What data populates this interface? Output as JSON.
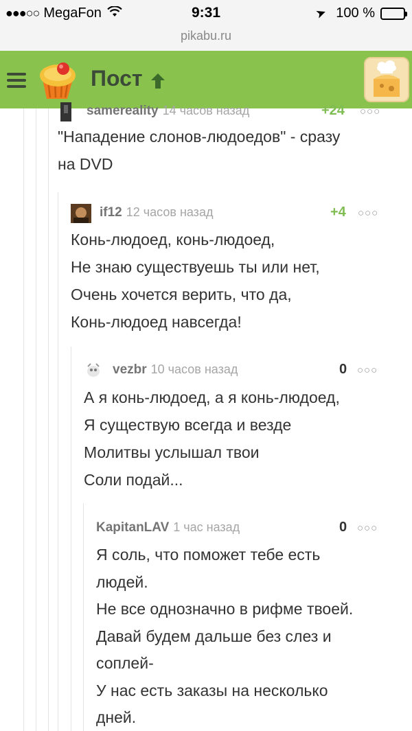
{
  "status_bar": {
    "carrier": "MegaFon",
    "time": "9:31",
    "battery": "100 %"
  },
  "url": "pikabu.ru",
  "header": {
    "title": "Пост"
  },
  "comments": [
    {
      "author": "samereality",
      "time": "14 часов назад",
      "rating": "+24",
      "lines": [
        "\"Нападение слонов-людоедов\" - сразу",
        "на DVD"
      ]
    },
    {
      "author": "if12",
      "time": "12 часов назад",
      "rating": "+4",
      "lines": [
        "Конь-людоед, конь-людоед,",
        "Не знаю существуешь ты или нет,",
        "Очень хочется верить, что да,",
        "Конь-людоед навсегда!"
      ]
    },
    {
      "author": "vezbr",
      "time": "10 часов назад",
      "rating": "0",
      "lines": [
        "А я конь-людоед, а я конь-людоед,",
        "Я существую всегда и везде",
        "Молитвы услышал твои",
        "Соли подай..."
      ]
    },
    {
      "author": "KapitanLAV",
      "time": "1 час назад",
      "rating": "0",
      "lines": [
        "Я соль, что поможет тебе есть",
        "людей.",
        "Не все однозначно в рифме твоей.",
        "Давай будем дальше без слез и",
        "соплей-",
        "У нас есть заказы на несколько",
        "дней."
      ]
    }
  ]
}
